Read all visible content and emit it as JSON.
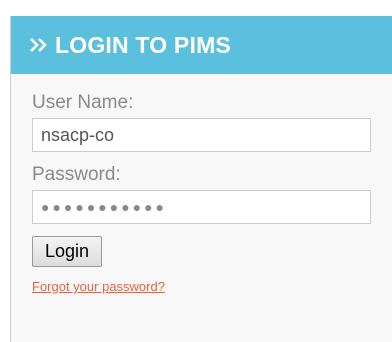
{
  "header": {
    "icon": "double-chevron-right-icon",
    "title": "LOGIN TO PIMS",
    "background": "#5bc0de"
  },
  "form": {
    "username_label": "User Name:",
    "username_value": "nsacp-co",
    "password_label": "Password:",
    "password_mask": "●●●●●●●●●●●",
    "login_label": "Login",
    "forgot_link": "Forgot your password?",
    "link_color": "#e8603c"
  }
}
